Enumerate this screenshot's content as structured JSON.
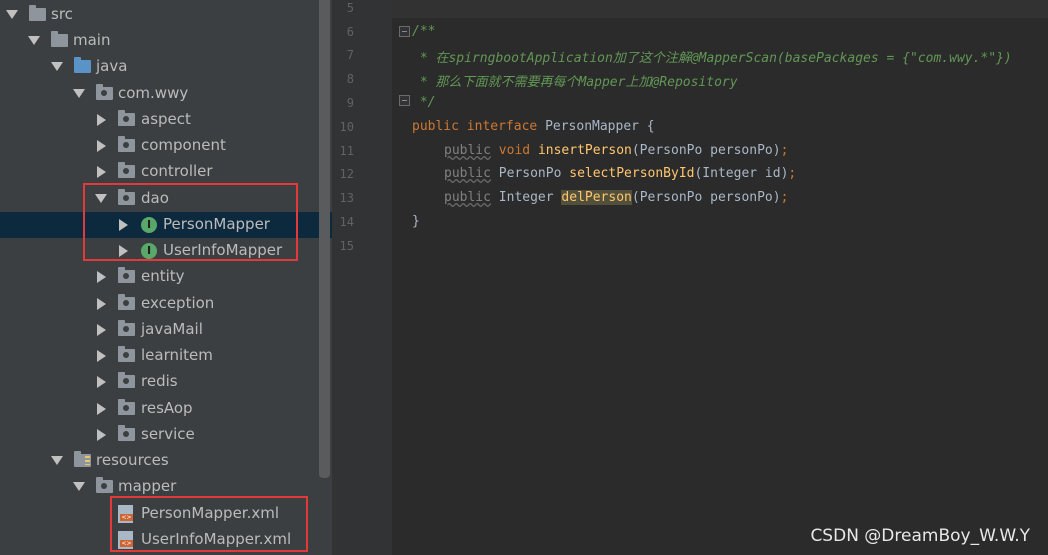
{
  "tree": {
    "items": [
      {
        "label": "src",
        "icon": "folder-icon"
      },
      {
        "label": "main",
        "icon": "folder-icon"
      },
      {
        "label": "java",
        "icon": "source-folder-icon"
      },
      {
        "label": "com.wwy",
        "icon": "package-icon"
      },
      {
        "label": "aspect",
        "icon": "package-icon"
      },
      {
        "label": "component",
        "icon": "package-icon"
      },
      {
        "label": "controller",
        "icon": "package-icon"
      },
      {
        "label": "dao",
        "icon": "package-icon"
      },
      {
        "label": "PersonMapper",
        "icon": "interface-icon"
      },
      {
        "label": "UserInfoMapper",
        "icon": "interface-icon"
      },
      {
        "label": "entity",
        "icon": "package-icon"
      },
      {
        "label": "exception",
        "icon": "package-icon"
      },
      {
        "label": "javaMail",
        "icon": "package-icon"
      },
      {
        "label": "learnitem",
        "icon": "package-icon"
      },
      {
        "label": "redis",
        "icon": "package-icon"
      },
      {
        "label": "resAop",
        "icon": "package-icon"
      },
      {
        "label": "service",
        "icon": "package-icon"
      },
      {
        "label": "resources",
        "icon": "resources-folder-icon"
      },
      {
        "label": "mapper",
        "icon": "package-icon"
      },
      {
        "label": "PersonMapper.xml",
        "icon": "xml-file-icon"
      },
      {
        "label": "UserInfoMapper.xml",
        "icon": "xml-file-icon"
      }
    ],
    "interface_badge": "I",
    "selected": "PersonMapper"
  },
  "editor": {
    "line_numbers": [
      "5",
      "6",
      "7",
      "8",
      "9",
      "10",
      "11",
      "12",
      "13",
      "14",
      "15"
    ],
    "code": {
      "l6": "/**",
      "l7_a": " * 在spirngbootApplication加了这个注解",
      "l7_b": "@MapperScan(basePackages = {\"com.wwy.*\"})",
      "l8_a": " * 那么下面就不需要再每个",
      "l8_b": "Mapper",
      "l8_c": "上加",
      "l8_d": "@Repository",
      "l9": " */",
      "l10_kw": "public interface ",
      "l10_name": "PersonMapper {",
      "l11_kw": "public",
      "l11_kw2": " void ",
      "l11_fn": "insertPerson",
      "l11_args": "(PersonPo personPo)",
      "l11_semi": ";",
      "l12_kw": "public",
      "l12_type": " PersonPo ",
      "l12_fn": "selectPersonById",
      "l12_args": "(Integer id)",
      "l12_semi": ";",
      "l13_kw": "public",
      "l13_type": " Integer ",
      "l13_fn": "delPerson",
      "l13_args": "(PersonPo personPo)",
      "l13_semi": ";",
      "l14": "}"
    }
  },
  "watermark": "CSDN @DreamBoy_W.W.Y",
  "colors": {
    "highlight_box": "#e23a3a",
    "selection": "#0d293e",
    "comment": "#629755",
    "keyword": "#cc7832",
    "method": "#ffc66d"
  }
}
